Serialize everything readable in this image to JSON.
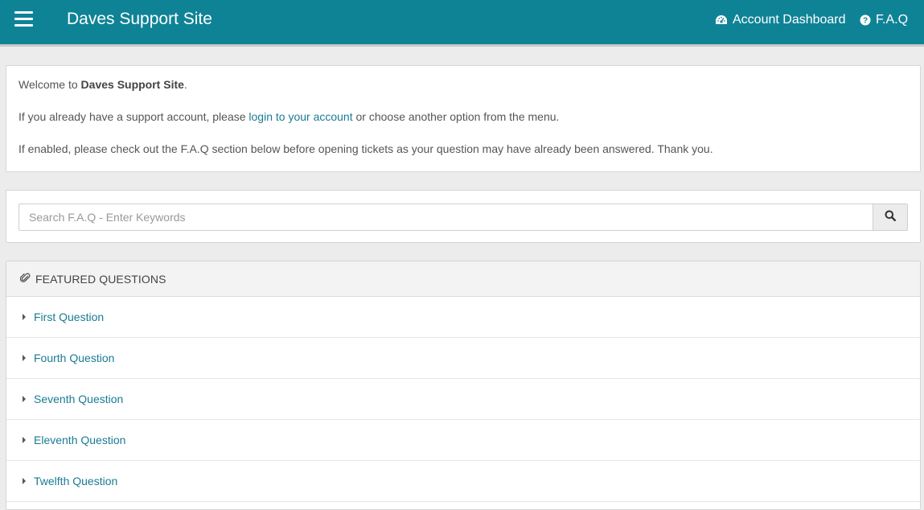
{
  "navbar": {
    "brand": "Daves Support Site",
    "links": [
      {
        "label": "Account Dashboard",
        "icon": "dashboard-icon"
      },
      {
        "label": "F.A.Q",
        "icon": "question-circle-icon"
      }
    ]
  },
  "welcome": {
    "line1_prefix": "Welcome to ",
    "line1_site": "Daves Support Site",
    "line1_suffix": ".",
    "line2_prefix": "If you already have a support account, please ",
    "line2_link": "login to your account",
    "line2_suffix": " or choose another option from the menu.",
    "line3": "If enabled, please check out the F.A.Q section below before opening tickets as your question may have already been answered. Thank you."
  },
  "search": {
    "placeholder": "Search F.A.Q - Enter Keywords",
    "value": "",
    "button_icon": "search-icon"
  },
  "featured": {
    "title": "FEATURED QUESTIONS",
    "icon": "paperclip-icon",
    "items": [
      {
        "label": "First Question"
      },
      {
        "label": "Fourth Question"
      },
      {
        "label": "Seventh Question"
      },
      {
        "label": "Eleventh Question"
      },
      {
        "label": "Twelfth Question"
      }
    ]
  },
  "colors": {
    "navbar": "#0f8396",
    "link": "#1a7b93",
    "background": "#ececec"
  }
}
